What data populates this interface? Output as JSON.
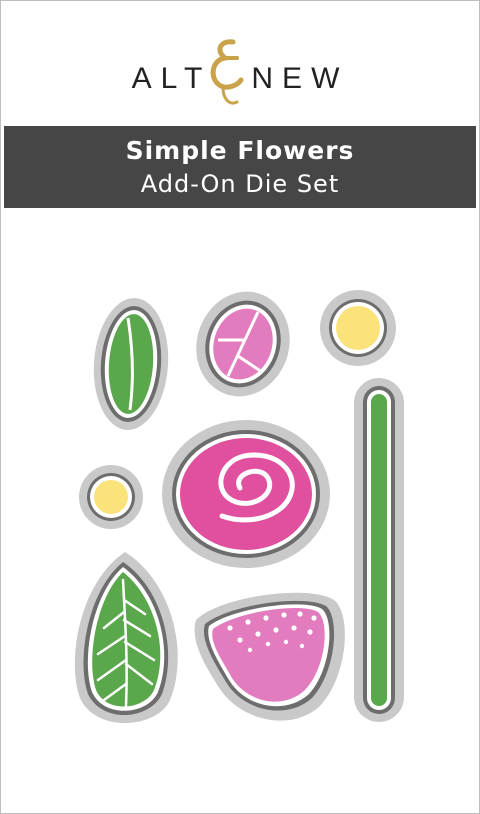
{
  "brand": {
    "name_before": "ALT",
    "name_after": "NEW",
    "logo_mark": "ampersand-e"
  },
  "product": {
    "title": "Simple Flowers",
    "subtitle": "Add-On Die Set"
  },
  "colors": {
    "banner": "#464646",
    "die_outline": "#c9c9c9",
    "leaf_green": "#5aa84b",
    "petal_pink": "#e37cbf",
    "rose_magenta": "#e0509f",
    "dot_yellow": "#fbe27a",
    "gold": "#c9a24a"
  },
  "dies": [
    {
      "name": "leaf-small"
    },
    {
      "name": "petal"
    },
    {
      "name": "dot-large"
    },
    {
      "name": "stem"
    },
    {
      "name": "dot-small"
    },
    {
      "name": "rose"
    },
    {
      "name": "leaf-veined"
    },
    {
      "name": "bud-dotted"
    }
  ]
}
